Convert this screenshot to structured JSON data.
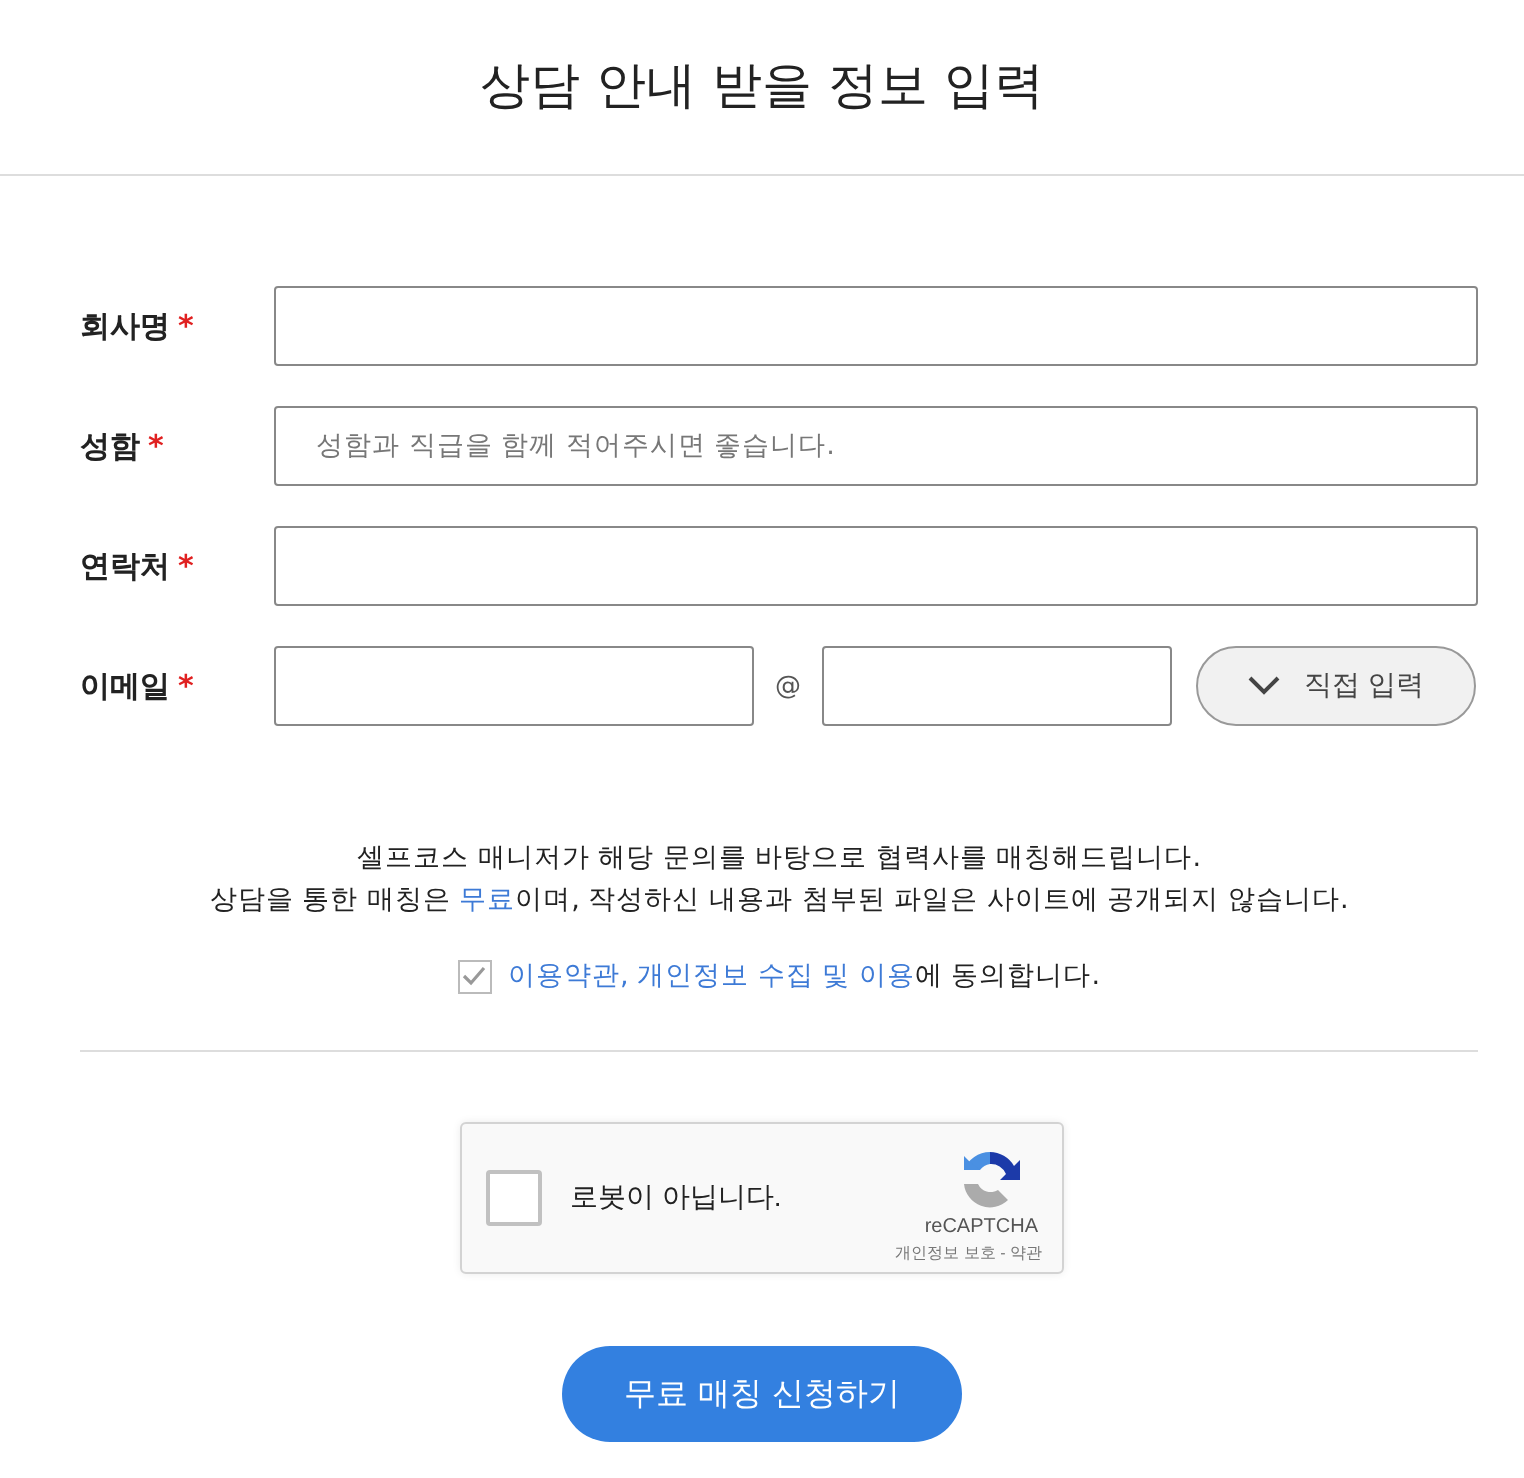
{
  "title": "상담 안내 받을 정보 입력",
  "fields": [
    {
      "kind": "text",
      "label": "회사명",
      "required_mark": "*"
    },
    {
      "kind": "text",
      "label": "성함",
      "required_mark": "*",
      "placeholder": "성함과 직급을 함께 적어주시면 좋습니다."
    },
    {
      "kind": "text",
      "label": "연락처",
      "required_mark": "*"
    },
    {
      "kind": "email",
      "label": "이메일",
      "required_mark": "*",
      "at": "@",
      "domain_button": "직접 입력"
    }
  ],
  "notice": {
    "line_1": "셀프코스 매니저가 해당 문의를 바탕으로 협력사를 매칭해드립니다.",
    "line_2_before": "상담을 통한 매칭은 ",
    "line_2_highlight": "무료",
    "line_2_after": "이며, 작성하신 내용과 첨부된 파일은 사이트에 공개되지 않습니다."
  },
  "agree": {
    "checked": true,
    "link": "이용약관, 개인정보 수집 및 이용",
    "text": "에 동의합니다."
  },
  "captcha": {
    "checked": false,
    "label": "로봇이 아닙니다.",
    "brand": "reCAPTCHA",
    "links": "개인정보 보호 - 약관"
  },
  "submit": "무료 매칭 신청하기"
}
